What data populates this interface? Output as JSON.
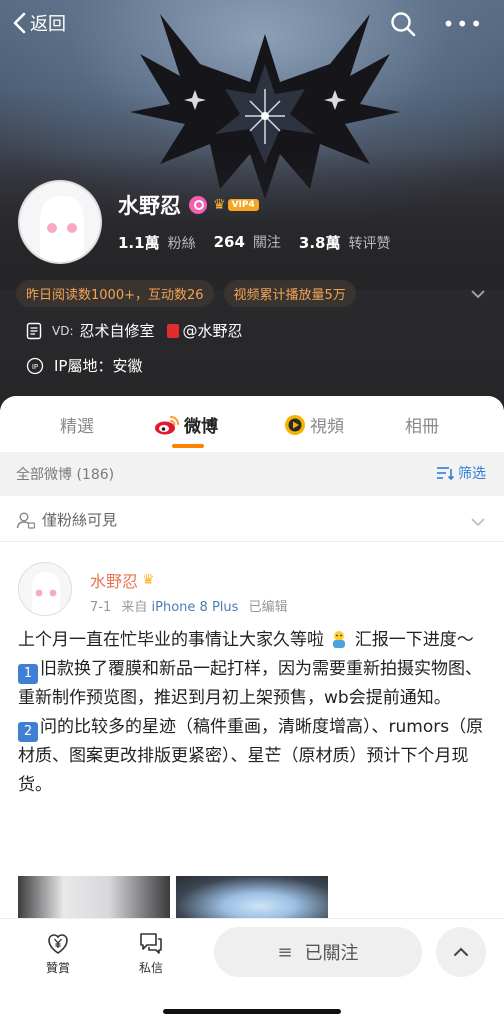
{
  "header": {
    "back_label": "返回",
    "profile": {
      "name": "水野忍",
      "vip_tag": "VIP4",
      "stats": [
        {
          "value": "1.1萬",
          "label": "粉絲"
        },
        {
          "value": "264",
          "label": "關注"
        },
        {
          "value": "3.8萬",
          "label": "转评赞"
        }
      ],
      "pills": [
        "昨日阅读数1000+，互动数26",
        "视频累计播放量5万"
      ],
      "vd_tag": "VD:",
      "vd_text": "忍术自修室",
      "vd_link": "@水野忍",
      "ip_text": "IP屬地：安徽"
    }
  },
  "tabs": [
    {
      "label": "精選",
      "active": false
    },
    {
      "label": "微博",
      "active": true
    },
    {
      "label": "視頻",
      "active": false
    },
    {
      "label": "相冊",
      "active": false
    }
  ],
  "filter": {
    "all_label": "全部微博 (186)",
    "filter_label": "筛选"
  },
  "visibility": {
    "label": "僅粉絲可見"
  },
  "post": {
    "author": "水野忍",
    "date": "7-1",
    "from_prefix": "来自",
    "device": "iPhone 8 Plus",
    "edited": "已编辑",
    "line1": "上个月一直在忙毕业的事情让大家久等啦",
    "line1b": "汇报一下进度～",
    "item1_num": "1",
    "item1_text": "旧款换了覆膜和新品一起打样，因为需要重新拍摄实物图、重新制作预览图，推迟到月初上架预售，wb会提前通知。",
    "item2_num": "2",
    "item2_text": "问的比较多的星迹（稿件重画，清晰度增高）、rumors（原材质、图案更改排版更紧密）、星芒（原材质）预计下个月现货。"
  },
  "bottom_bar": {
    "reward_label": "贊賞",
    "message_label": "私信",
    "follow_label": "已關注"
  },
  "colors": {
    "accent_orange": "#ff8200",
    "link_blue": "#2d7fd3",
    "name_orange": "#eb7350"
  }
}
